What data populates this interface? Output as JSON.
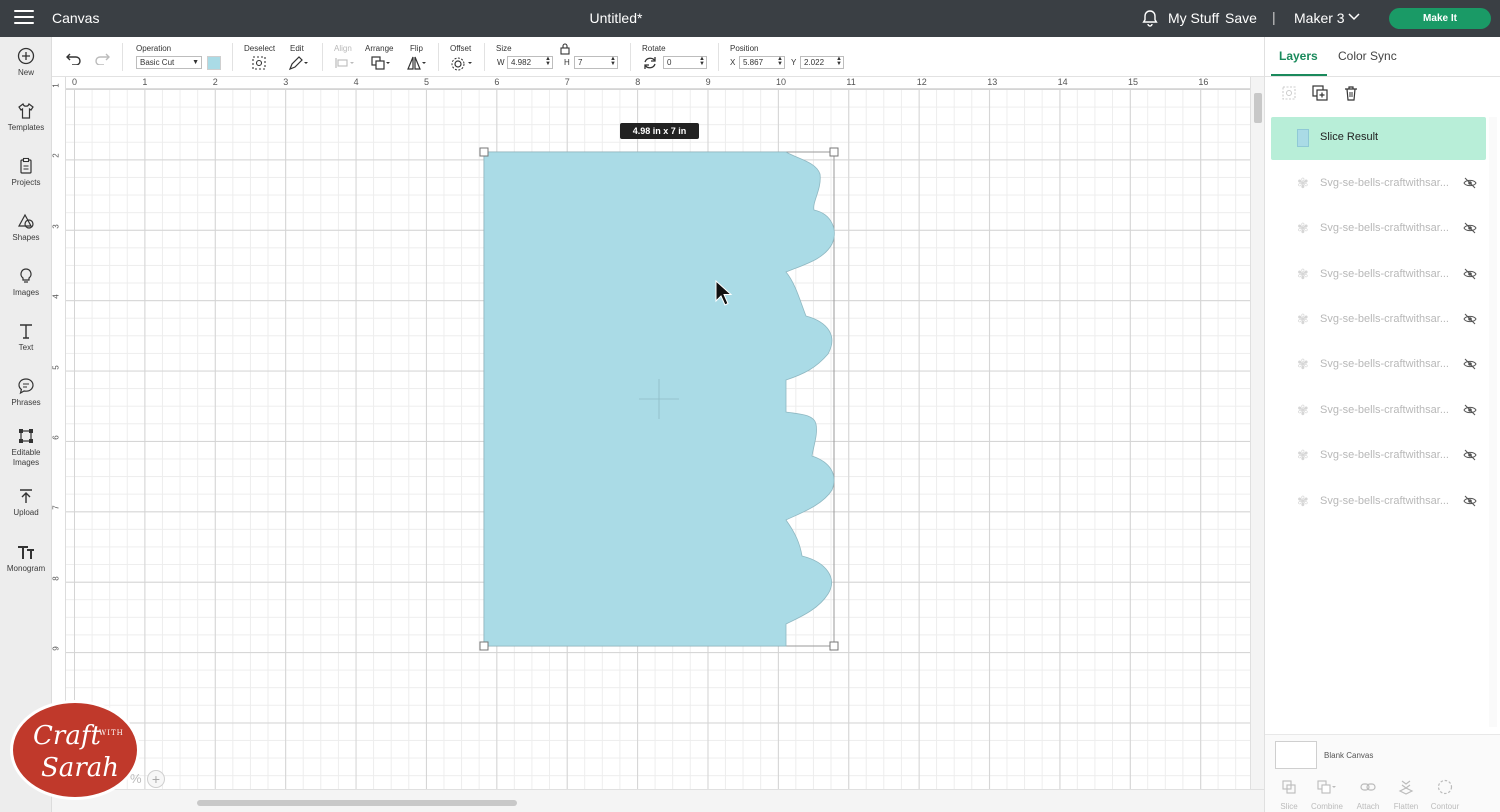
{
  "topbar": {
    "app_name": "Canvas",
    "doc_title": "Untitled*",
    "my_stuff": "My Stuff",
    "save": "Save",
    "separator": "|",
    "machine": "Maker 3",
    "make_it": "Make It",
    "accent_color": "#1a9a66"
  },
  "sidebar": {
    "items": [
      {
        "label": "New",
        "icon": "plus-circle-icon"
      },
      {
        "label": "Templates",
        "icon": "shirt-icon"
      },
      {
        "label": "Projects",
        "icon": "clipboard-icon"
      },
      {
        "label": "Shapes",
        "icon": "shapes-icon"
      },
      {
        "label": "Images",
        "icon": "lightbulb-icon"
      },
      {
        "label": "Text",
        "icon": "text-t-icon"
      },
      {
        "label": "Phrases",
        "icon": "speech-bubble-icon"
      },
      {
        "label": "Editable",
        "label2": "Images",
        "icon": "edit-crop-icon"
      },
      {
        "label": "Upload",
        "icon": "upload-icon"
      },
      {
        "label": "Monogram",
        "icon": "monogram-icon"
      }
    ]
  },
  "toolbar": {
    "operation_label": "Operation",
    "operation_value": "Basic Cut",
    "deselect_label": "Deselect",
    "edit_label": "Edit",
    "align_label": "Align",
    "arrange_label": "Arrange",
    "flip_label": "Flip",
    "offset_label": "Offset",
    "size_label": "Size",
    "w_label": "W",
    "w_value": "4.982",
    "h_label": "H",
    "h_value": "7",
    "rotate_label": "Rotate",
    "rotate_value": "0",
    "position_label": "Position",
    "x_label": "X",
    "x_value": "5.867",
    "y_label": "Y",
    "y_value": "2.022",
    "swatch_color": "#aadbe6"
  },
  "canvas": {
    "ruler_top": [
      "0",
      "1",
      "2",
      "3",
      "4",
      "5",
      "6",
      "7",
      "8",
      "9",
      "10",
      "11",
      "12",
      "13",
      "14",
      "15",
      "16"
    ],
    "ruler_left": [
      "1",
      "2",
      "3",
      "4",
      "5",
      "6",
      "7",
      "8",
      "9"
    ],
    "size_tooltip": "4.98  in x 7  in",
    "shape_color": "#aadbe6",
    "zoom_percent": "%",
    "zoom_plus": "+"
  },
  "watermark": {
    "line1": "Craft",
    "line2": "WITH",
    "line3": "Sarah"
  },
  "right_panel": {
    "tabs": [
      "Layers",
      "Color Sync"
    ],
    "selected_layer": "Slice Result",
    "layers": [
      "Svg-se-bells-craftwithsar...",
      "Svg-se-bells-craftwithsar...",
      "Svg-se-bells-craftwithsar...",
      "Svg-se-bells-craftwithsar...",
      "Svg-se-bells-craftwithsar...",
      "Svg-se-bells-craftwithsar...",
      "Svg-se-bells-craftwithsar...",
      "Svg-se-bells-craftwithsar..."
    ],
    "blank_canvas": "Blank Canvas",
    "bottom_tools": [
      "Slice",
      "Combine",
      "Attach",
      "Flatten",
      "Contour"
    ]
  }
}
